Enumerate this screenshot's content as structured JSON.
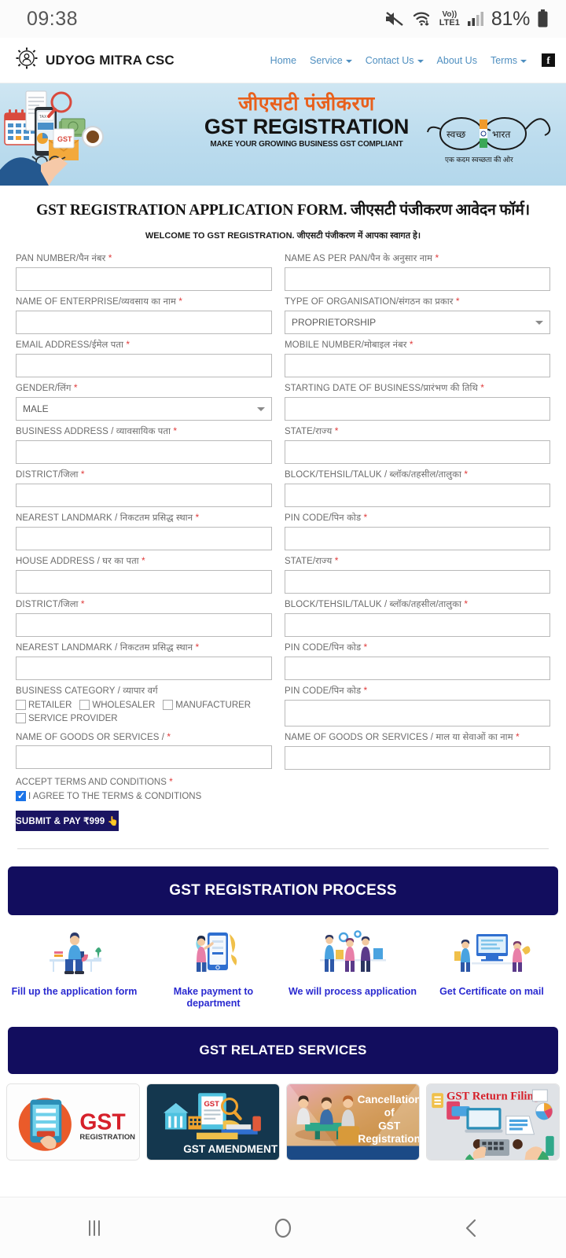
{
  "statusbar": {
    "time": "09:38",
    "battery_percent": "81%",
    "network_label_top": "Vo))",
    "network_label_bottom": "LTE1",
    "icons": [
      "mute-icon",
      "wifi-icon",
      "volte-icon",
      "signal-icon",
      "battery-icon"
    ]
  },
  "header": {
    "brand": "UDYOG MITRA CSC",
    "logo_icon": "gear-person-icon",
    "nav": [
      {
        "label": "Home",
        "has_caret": false
      },
      {
        "label": "Service",
        "has_caret": true
      },
      {
        "label": "Contact Us",
        "has_caret": true
      },
      {
        "label": "About Us",
        "has_caret": false
      },
      {
        "label": "Terms",
        "has_caret": true
      }
    ],
    "social": {
      "icon": "facebook-icon",
      "glyph": "f"
    }
  },
  "banner": {
    "hindi_title": "जीएसटी पंजीकरण",
    "title": "GST REGISTRATION",
    "subtitle": "MAKE YOUR GROWING BUSINESS GST COMPLIANT",
    "emblem_left": "स्वच्छ",
    "emblem_right": "भारत",
    "emblem_caption": "एक कदम स्वच्छता की ओर"
  },
  "form": {
    "title": "GST REGISTRATION APPLICATION FORM. जीएसटी पंजीकरण आवेदन फॉर्म।",
    "subtitle": "WELCOME TO GST REGISTRATION. जीएसटी पंजीकरण में आपका स्वागत हे।",
    "fields": [
      {
        "label": "PAN NUMBER/पैन नंबर",
        "required": true,
        "type": "text",
        "value": ""
      },
      {
        "label": "NAME AS PER PAN/पैन के अनुसार नाम",
        "required": true,
        "type": "text",
        "value": ""
      },
      {
        "label": "NAME OF ENTERPRISE/व्यवसाय का नाम",
        "required": true,
        "type": "text",
        "value": ""
      },
      {
        "label": "TYPE OF ORGANISATION/संगठन का प्रकार",
        "required": true,
        "type": "select",
        "value": "PROPRIETORSHIP"
      },
      {
        "label": "EMAIL ADDRESS/ईमेल पता",
        "required": true,
        "type": "text",
        "value": ""
      },
      {
        "label": "MOBILE NUMBER/मोबाइल नंबर",
        "required": true,
        "type": "text",
        "value": ""
      },
      {
        "label": "GENDER/लिंग",
        "required": true,
        "type": "select",
        "value": "MALE"
      },
      {
        "label": "STARTING DATE OF BUSINESS/प्रारंभण की तिथि",
        "required": true,
        "type": "text",
        "value": ""
      },
      {
        "label": "BUSINESS ADDRESS / व्यावसायिक पता",
        "required": true,
        "type": "text",
        "value": ""
      },
      {
        "label": "STATE/राज्य",
        "required": true,
        "type": "text",
        "value": ""
      },
      {
        "label": "DISTRICT/जिला",
        "required": true,
        "type": "text",
        "value": ""
      },
      {
        "label": "BLOCK/TEHSIL/TALUK / ब्लॉक/तहसील/तालुका",
        "required": true,
        "type": "text",
        "value": ""
      },
      {
        "label": "NEAREST LANDMARK / निकटतम प्रसिद्ध स्थान",
        "required": true,
        "type": "text",
        "value": ""
      },
      {
        "label": "PIN CODE/पिन कोड",
        "required": true,
        "type": "text",
        "value": ""
      },
      {
        "label": "HOUSE ADDRESS / घर का पता",
        "required": true,
        "type": "text",
        "value": ""
      },
      {
        "label": "STATE/राज्य",
        "required": true,
        "type": "text",
        "value": ""
      },
      {
        "label": "DISTRICT/जिला",
        "required": true,
        "type": "text",
        "value": ""
      },
      {
        "label": "BLOCK/TEHSIL/TALUK / ब्लॉक/तहसील/तालुका",
        "required": true,
        "type": "text",
        "value": ""
      },
      {
        "label": "NEAREST LANDMARK / निकटतम प्रसिद्ध स्थान",
        "required": true,
        "type": "text",
        "value": ""
      },
      {
        "label": "PIN CODE/पिन कोड",
        "required": true,
        "type": "text",
        "value": ""
      }
    ],
    "business_category": {
      "label": "BUSINESS CATEGORY / व्यापार वर्ग",
      "required": false,
      "options": [
        {
          "label": "RETAILER",
          "checked": false
        },
        {
          "label": "WHOLESALER",
          "checked": false
        },
        {
          "label": "MANUFACTURER",
          "checked": false
        },
        {
          "label": "SERVICE PROVIDER",
          "checked": false
        }
      ]
    },
    "pin_code_right": {
      "label": "PIN CODE/पिन कोड",
      "required": true,
      "value": ""
    },
    "goods_left": {
      "label": "NAME OF GOODS OR SERVICES /",
      "required": true,
      "value": ""
    },
    "goods_right": {
      "label": "NAME OF GOODS OR SERVICES / माल या सेवाओं का नाम",
      "required": true,
      "value": ""
    },
    "terms": {
      "label": "ACCEPT TERMS AND CONDITIONS",
      "required": true,
      "checkbox_label": "I AGREE TO THE TERMS & CONDITIONS",
      "checked": true
    },
    "submit_label": "SUBMIT & PAY ₹999 👆"
  },
  "process": {
    "heading": "GST REGISTRATION PROCESS",
    "steps": [
      {
        "label": "Fill up the application form",
        "icon": "desk-laptop-icon"
      },
      {
        "label": "Make payment to department",
        "icon": "mobile-payment-icon"
      },
      {
        "label": "We will process application",
        "icon": "team-process-icon"
      },
      {
        "label": "Get Certificate on mail",
        "icon": "certificate-mail-icon"
      }
    ]
  },
  "services": {
    "heading": "GST RELATED SERVICES",
    "cards": [
      {
        "name": "gst-registration-card",
        "title": "GST REGISTRATION"
      },
      {
        "name": "gst-amendment-card",
        "title": "GST AMENDMENT"
      },
      {
        "name": "gst-cancellation-card",
        "title": "Cancellation of GST Registration"
      },
      {
        "name": "gst-return-filing-card",
        "title": "GST Return Filing"
      }
    ]
  },
  "androidnav": {
    "buttons": [
      {
        "name": "recents-button",
        "icon": "recents-icon"
      },
      {
        "name": "home-button",
        "icon": "home-circle-icon"
      },
      {
        "name": "back-button",
        "icon": "back-chevron-icon"
      }
    ]
  },
  "colors": {
    "brand_navy": "#120d5e",
    "nav_link": "#4f8fc0",
    "accent_orange": "#e8601c",
    "step_text": "#2a2ad0",
    "required_red": "#e03b3b"
  }
}
